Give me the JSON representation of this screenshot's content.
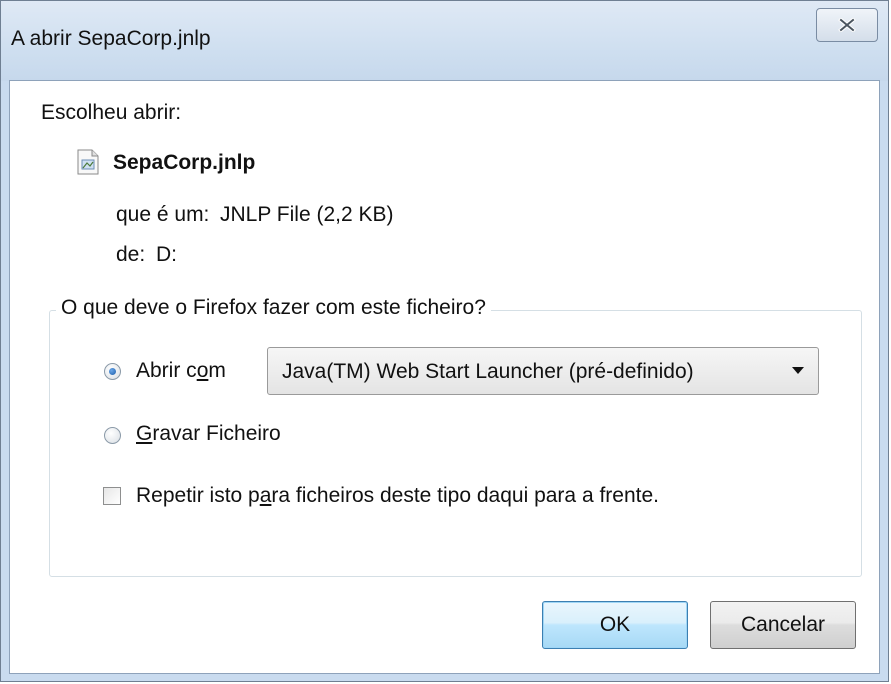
{
  "window": {
    "title": "A abrir SepaCorp.jnlp",
    "close_icon": "close-icon"
  },
  "content": {
    "intro_label": "Escolheu abrir:",
    "file_icon": "jnlp-file-icon",
    "file_name": "SepaCorp.jnlp",
    "type_label": "que é um:",
    "type_value": "JNLP File (2,2 KB)",
    "from_label": "de:",
    "from_value": "D:"
  },
  "action_group": {
    "legend": "O que deve o Firefox fazer com este ficheiro?",
    "open_with": {
      "label_pre": "Abrir c",
      "label_accel": "o",
      "label_post": "m",
      "checked": true,
      "selected_app": "Java(TM) Web Start Launcher (pré-definido)"
    },
    "save_file": {
      "label_accel": "G",
      "label_post": "ravar Ficheiro",
      "checked": false
    },
    "repeat": {
      "label_pre": "Repetir isto p",
      "label_accel": "a",
      "label_post": "ra ficheiros deste tipo daqui para a frente.",
      "checked": false
    }
  },
  "buttons": {
    "ok_label": "OK",
    "cancel_label": "Cancelar"
  }
}
